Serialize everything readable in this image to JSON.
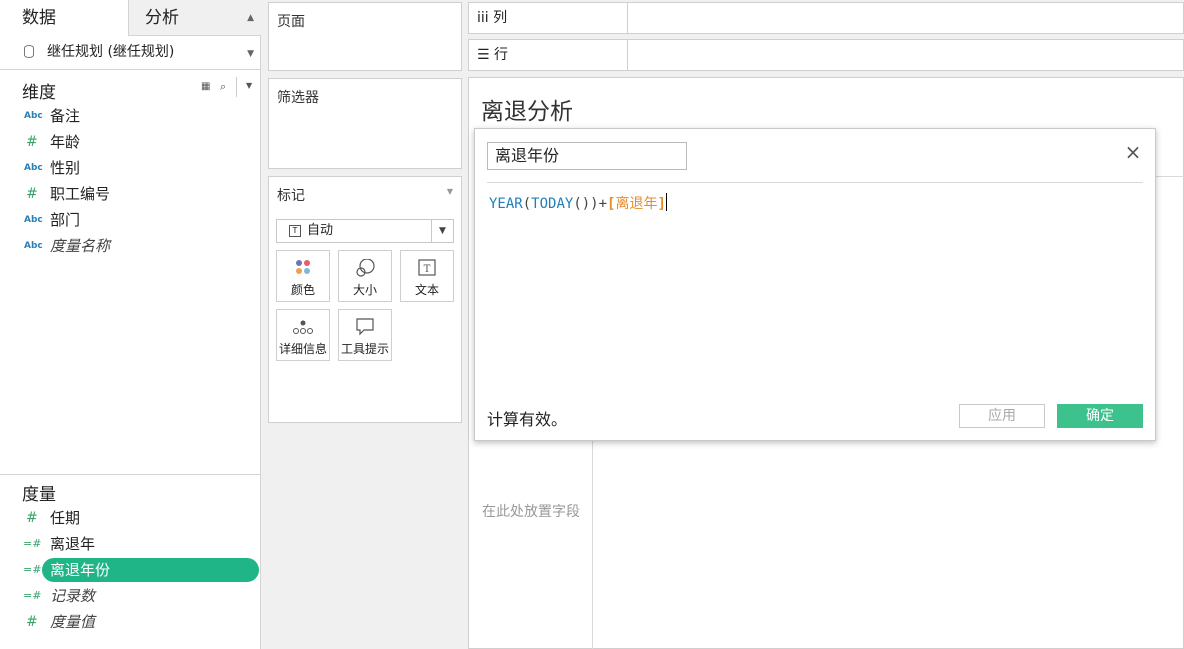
{
  "tabs": {
    "data": "数据",
    "analysis": "分析"
  },
  "datasource": {
    "name": "继任规划 (继任规划)"
  },
  "dimensions": {
    "title": "维度",
    "items": [
      {
        "type": "Abc",
        "label": "备注"
      },
      {
        "type": "#",
        "label": "年龄"
      },
      {
        "type": "Abc",
        "label": "性别"
      },
      {
        "type": "#",
        "label": "职工编号"
      },
      {
        "type": "Abc",
        "label": "部门"
      },
      {
        "type": "Abc",
        "label": "度量名称"
      }
    ]
  },
  "measures": {
    "title": "度量",
    "items": [
      {
        "type": "#",
        "label": "任期"
      },
      {
        "type": "=#",
        "label": "离退年"
      },
      {
        "type": "=#",
        "label": "离退年份"
      },
      {
        "type": "=#",
        "label": "记录数"
      },
      {
        "type": "#",
        "label": "度量值"
      }
    ]
  },
  "cards": {
    "pages": "页面",
    "filters": "筛选器",
    "marks": "标记"
  },
  "marks": {
    "type": "自动",
    "type_icon": "T",
    "buttons": [
      "颜色",
      "大小",
      "文本",
      "详细信息",
      "工具提示"
    ]
  },
  "shelves": {
    "columns": "列",
    "rows": "行",
    "columns_icon": "iii",
    "rows_icon": "☰"
  },
  "viz": {
    "title": "离退分析",
    "drop_hint": "在此处放置字段"
  },
  "calc": {
    "name": "离退年份",
    "formula": {
      "fn1": "YEAR",
      "fn2": "TODAY",
      "field": "离退年"
    },
    "status": "计算有效。",
    "apply": "应用",
    "ok": "确定",
    "close": "×"
  },
  "colors": {
    "accent": "#1fb586",
    "ok_button": "#3dc18d",
    "function": "#1f7fb9",
    "field": "#e88b2a"
  }
}
